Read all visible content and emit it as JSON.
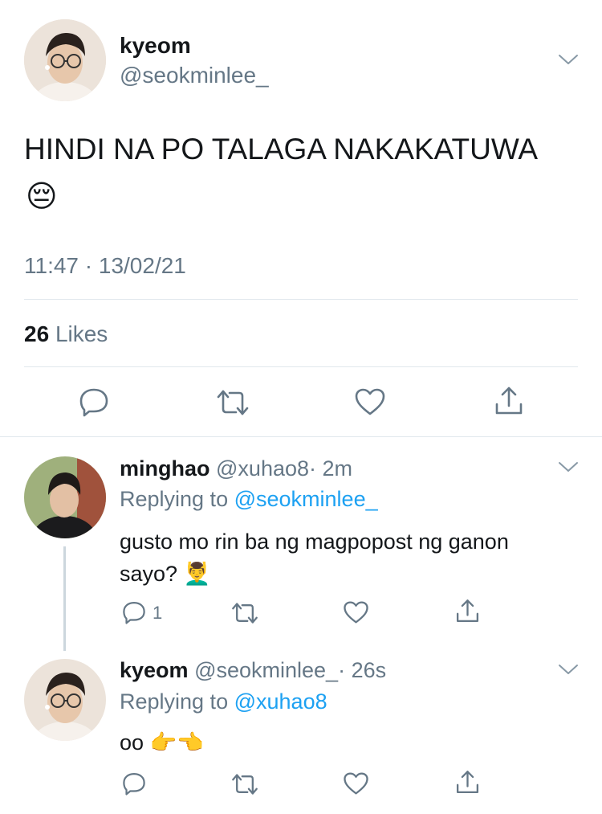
{
  "main_tweet": {
    "author_name": "kyeom",
    "author_handle": "@seokminlee_",
    "text": "HINDI NA PO TALAGA NAKAKATUWA",
    "emoji": "😔",
    "timestamp": "11:47 · 13/02/21",
    "likes_count": "26",
    "likes_label": "Likes"
  },
  "replies": [
    {
      "author_name": "minghao",
      "author_handle": "@xuhao8",
      "time": "· 2m",
      "replying_label": "Replying to",
      "replying_to": "@seokminlee_",
      "text_line1": "gusto mo rin ba ng magpopost ng ganon",
      "text_line2": "sayo?",
      "emoji": "💆‍♂️",
      "reply_count": "1"
    },
    {
      "author_name": "kyeom",
      "author_handle": "@seokminlee_",
      "time": "· 26s",
      "replying_label": "Replying to",
      "replying_to": "@xuhao8",
      "text": "oo",
      "emoji": "👉👈"
    }
  ],
  "icons": {
    "reply": "reply-icon",
    "retweet": "retweet-icon",
    "like": "heart-icon",
    "share": "share-icon",
    "menu": "chevron-down-icon"
  },
  "colors": {
    "link": "#1da1f2",
    "muted": "#657786",
    "divider": "#e1e8ed"
  }
}
